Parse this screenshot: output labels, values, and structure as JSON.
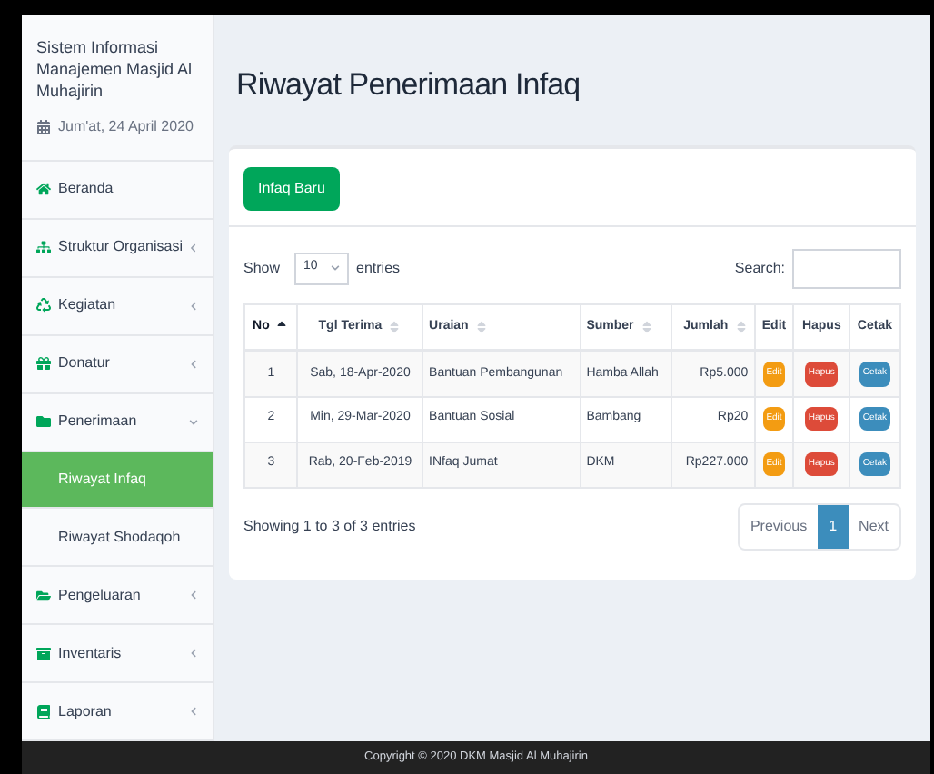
{
  "sidebar": {
    "app_name": "Sistem Informasi Manajemen Masjid Al Muhajirin",
    "date": "Jum'at, 24 April 2020",
    "items": [
      {
        "label": "Beranda",
        "expandable": false,
        "expanded": false,
        "selected": false
      },
      {
        "label": "Struktur Organisasi",
        "expandable": true,
        "expanded": false,
        "selected": false
      },
      {
        "label": "Kegiatan",
        "expandable": true,
        "expanded": false,
        "selected": false
      },
      {
        "label": "Donatur",
        "expandable": true,
        "expanded": false,
        "selected": false
      },
      {
        "label": "Penerimaan",
        "expandable": true,
        "expanded": true,
        "selected": false,
        "children": [
          {
            "label": "Riwayat Infaq",
            "selected": true
          },
          {
            "label": "Riwayat Shodaqoh",
            "selected": false
          }
        ]
      },
      {
        "label": "Pengeluaran",
        "expandable": true,
        "expanded": false,
        "selected": false
      },
      {
        "label": "Inventaris",
        "expandable": true,
        "expanded": false,
        "selected": false
      },
      {
        "label": "Laporan",
        "expandable": true,
        "expanded": false,
        "selected": false
      }
    ]
  },
  "page_title": "Riwayat Penerimaan Infaq",
  "add_button": "Infaq Baru",
  "length": {
    "before": "Show",
    "value": "10",
    "after": "entries"
  },
  "search": {
    "label": "Search:"
  },
  "table": {
    "columns": [
      {
        "label": "No",
        "sortable": true,
        "sorted": true
      },
      {
        "label": "Tgl Terima",
        "sortable": true,
        "sorted": false
      },
      {
        "label": "Uraian",
        "sortable": true,
        "sorted": false
      },
      {
        "label": "Sumber",
        "sortable": true,
        "sorted": false
      },
      {
        "label": "Jumlah",
        "sortable": true,
        "sorted": false
      },
      {
        "label": "Edit",
        "sortable": false,
        "sorted": false
      },
      {
        "label": "Hapus",
        "sortable": false,
        "sorted": false
      },
      {
        "label": "Cetak",
        "sortable": false,
        "sorted": false
      }
    ],
    "rows": [
      {
        "cells": [
          "1",
          "Sab, 18-Apr-2020",
          "Bantuan Pembangunan",
          "Hamba Allah",
          "Rp5.000"
        ],
        "actions": [
          {
            "kind": "edit",
            "label": "Edit"
          },
          {
            "kind": "delete",
            "label": "Hapus"
          },
          {
            "kind": "print",
            "label": "Cetak"
          }
        ]
      },
      {
        "cells": [
          "2",
          "Min, 29-Mar-2020",
          "Bantuan Sosial",
          "Bambang",
          "Rp20"
        ],
        "actions": [
          {
            "kind": "edit",
            "label": "Edit"
          },
          {
            "kind": "delete",
            "label": "Hapus"
          },
          {
            "kind": "print",
            "label": "Cetak"
          }
        ]
      },
      {
        "cells": [
          "3",
          "Rab, 20-Feb-2019",
          "INfaq Jumat",
          "DKM",
          "Rp227.000"
        ],
        "actions": [
          {
            "kind": "edit",
            "label": "Edit"
          },
          {
            "kind": "delete",
            "label": "Hapus"
          },
          {
            "kind": "print",
            "label": "Cetak"
          }
        ]
      }
    ]
  },
  "info": "Showing 1 to 3 of 3 entries",
  "pagination": [
    {
      "label": "Previous",
      "selected": false
    },
    {
      "label": "1",
      "selected": true
    },
    {
      "label": "Next",
      "selected": false
    }
  ],
  "footer": "Copyright © 2020 DKM Masjid Al Muhajirin"
}
